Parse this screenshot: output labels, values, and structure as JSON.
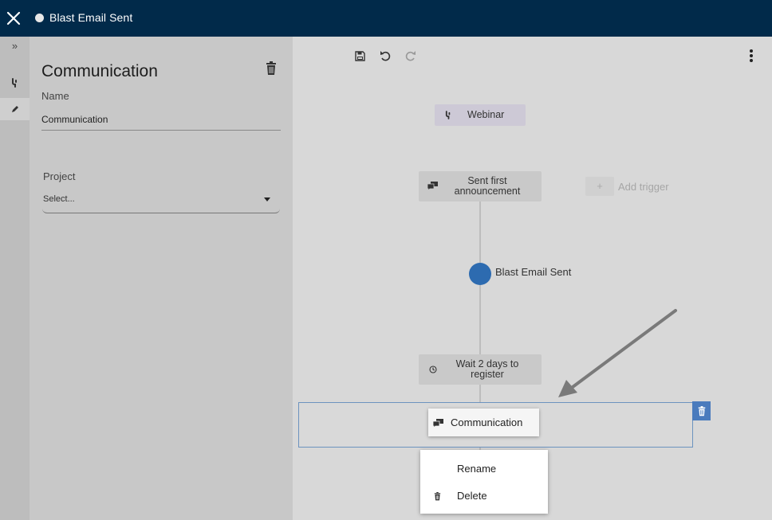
{
  "window": {
    "title": "Blast Email Sent",
    "close_icon": "close-icon"
  },
  "rail": {
    "items": [
      {
        "name": "expand",
        "icon": "double-chevron-right-icon",
        "glyph": "»"
      },
      {
        "name": "flow",
        "icon": "flow-icon"
      },
      {
        "name": "edit",
        "icon": "pencil-icon"
      }
    ]
  },
  "panel": {
    "title": "Communication",
    "name_label": "Name",
    "name_value": "Communication",
    "project_label": "Project",
    "project_value": "Select..."
  },
  "toolbar": {
    "save_icon": "save-icon",
    "undo_icon": "undo-icon",
    "redo_icon": "redo-icon",
    "more_icon": "kebab-menu-icon"
  },
  "flow": {
    "trigger": {
      "label": "Webinar",
      "icon": "flow-icon"
    },
    "nodes": {
      "sent": {
        "line1": "Sent first",
        "line2": "announcement",
        "icon": "chat-icon"
      },
      "wait": {
        "line1": "Wait 2 days to",
        "line2": "register",
        "icon": "clock-icon"
      },
      "communication": {
        "label": "Communication",
        "icon": "chat-icon"
      }
    },
    "event": {
      "label": "Blast Email Sent"
    },
    "add_trigger": {
      "plus": "+",
      "label": "Add trigger"
    }
  },
  "context_menu": {
    "rename": "Rename",
    "delete": "Delete"
  },
  "colors": {
    "topbar": "#012a4a",
    "accent": "#2d6bb0",
    "selection": "#4a7bbd"
  }
}
